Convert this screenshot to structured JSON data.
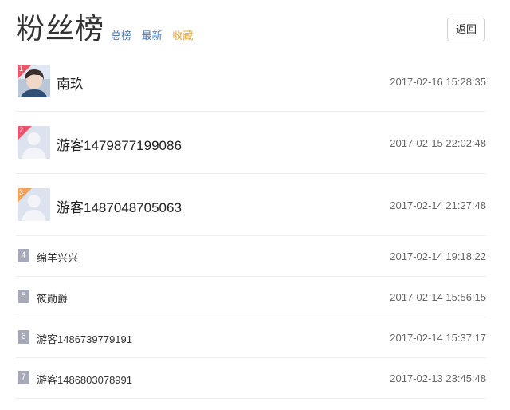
{
  "header": {
    "title": "粉丝榜",
    "tabs": [
      "总榜",
      "最新",
      "收藏"
    ],
    "back_label": "返回"
  },
  "list": [
    {
      "rank": "1",
      "name": "南玖",
      "time": "2017-02-16 15:28:35",
      "avatar": "photo"
    },
    {
      "rank": "2",
      "name": "游客1479877199086",
      "time": "2017-02-15 22:02:48",
      "avatar": "default"
    },
    {
      "rank": "3",
      "name": "游客1487048705063",
      "time": "2017-02-14 21:27:48",
      "avatar": "default"
    },
    {
      "rank": "4",
      "name": "绵羊兴兴",
      "time": "2017-02-14 19:18:22"
    },
    {
      "rank": "5",
      "name": "筱勋爵",
      "time": "2017-02-14 15:56:15"
    },
    {
      "rank": "6",
      "name": "游客1486739779191",
      "time": "2017-02-14 15:37:17"
    },
    {
      "rank": "7",
      "name": "游客1486803078991",
      "time": "2017-02-13 23:45:48"
    }
  ],
  "colors": {
    "tab_blue": "#4a78b3",
    "tab_gold": "#e3a53a",
    "rank_red": "#e8576a",
    "rank_orange": "#f0a35b",
    "rank_gray": "#a7a9b8"
  }
}
